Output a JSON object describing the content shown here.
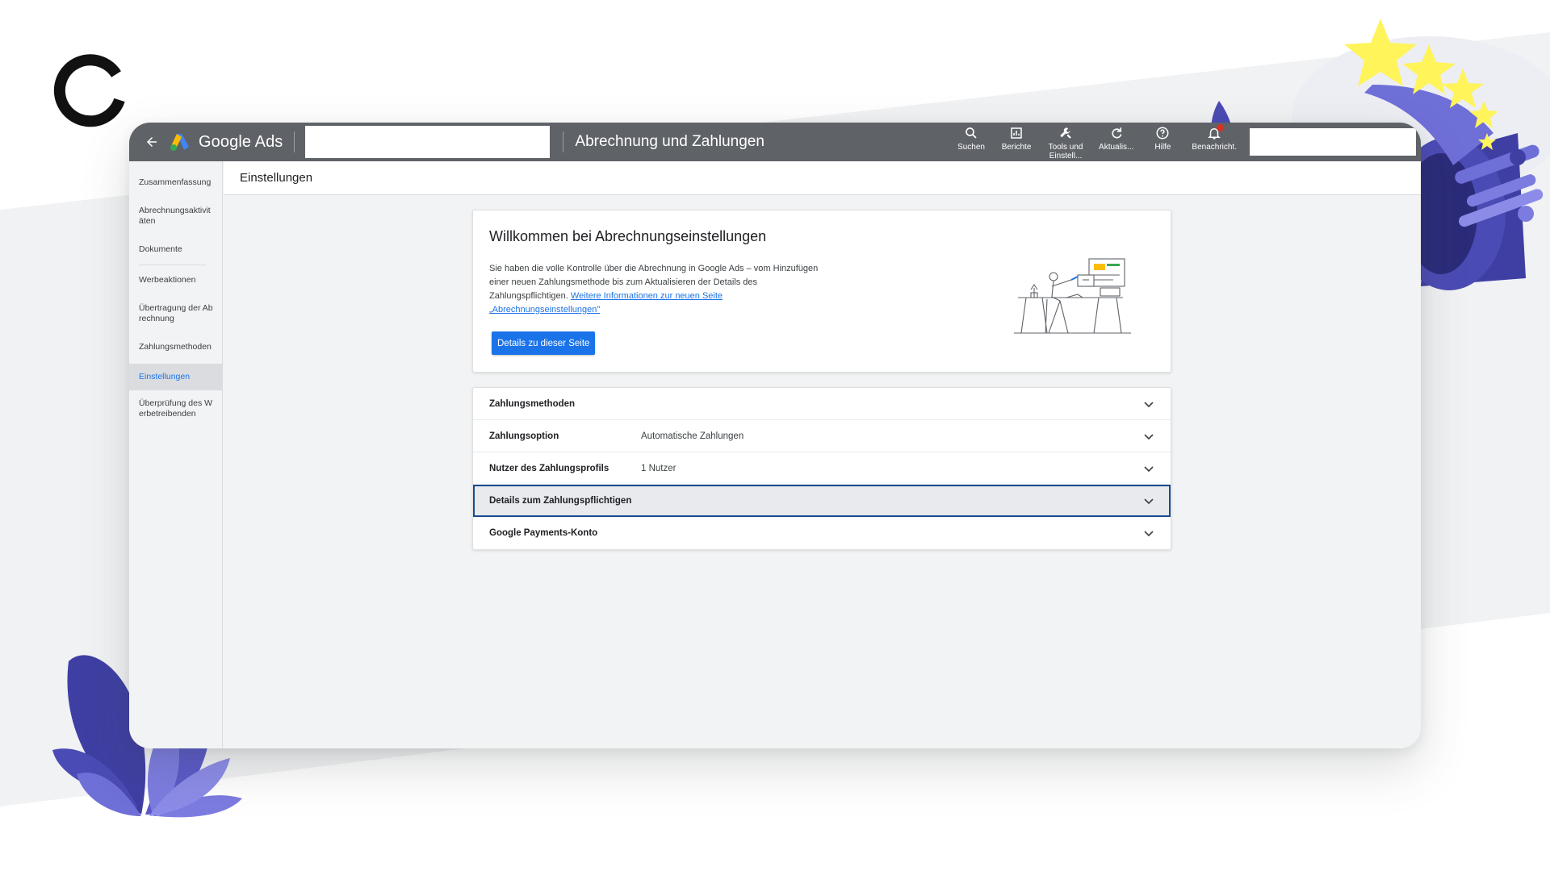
{
  "app": {
    "brand": "Google Ads",
    "page_title": "Abrechnung und Zahlungen"
  },
  "toolbar": [
    {
      "label": "Suchen",
      "icon": "search-icon"
    },
    {
      "label": "Berichte",
      "icon": "reports-icon"
    },
    {
      "label": "Tools und Einstell...",
      "icon": "wrench-icon"
    },
    {
      "label": "Aktualis...",
      "icon": "refresh-icon"
    },
    {
      "label": "Hilfe",
      "icon": "help-icon"
    },
    {
      "label": "Benachricht.",
      "icon": "bell-icon"
    }
  ],
  "sidebar": {
    "items": [
      {
        "label": "Zusammenfassung"
      },
      {
        "label": "Abrechnungsaktivitäten"
      },
      {
        "label": "Dokumente"
      },
      {
        "label": "Werbeaktionen"
      },
      {
        "label": "Übertragung der Abrechnung"
      },
      {
        "label": "Zahlungsmethoden"
      },
      {
        "label": "Einstellungen",
        "active": true
      },
      {
        "label": "Überprüfung des Werbetreibenden"
      }
    ]
  },
  "breadcrumb": "Einstellungen",
  "welcome": {
    "title": "Willkommen bei Abrechnungseinstellungen",
    "text": "Sie haben die volle Kontrolle über die Abrechnung in Google Ads – vom Hinzufügen einer neuen Zahlungsmethode bis zum Aktualisieren der Details des Zahlungspflichtigen. ",
    "link": "Weitere Informationen zur neuen Seite „Abrechnungseinstellungen\"",
    "button": "Details zu dieser Seite"
  },
  "sections": [
    {
      "label": "Zahlungsmethoden",
      "value": ""
    },
    {
      "label": "Zahlungsoption",
      "value": "Automatische Zahlungen"
    },
    {
      "label": "Nutzer des Zahlungsprofils",
      "value": "1 Nutzer"
    },
    {
      "label": "Details zum Zahlungspflichtigen",
      "value": ""
    },
    {
      "label": "Google Payments-Konto",
      "value": ""
    }
  ],
  "colors": {
    "topbar": "#5f6368",
    "accent": "#1a73e8",
    "deco_purple": "#6f6fd8",
    "deco_dark": "#3f3fa3",
    "stars": "#fff45a"
  }
}
